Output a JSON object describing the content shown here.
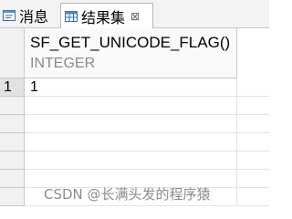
{
  "tabs": [
    {
      "label": "消息",
      "icon": "messages-icon",
      "active": false
    },
    {
      "label": "结果集",
      "icon": "table-icon",
      "active": true,
      "close": "⊠"
    }
  ],
  "grid": {
    "column": {
      "name": "SF_GET_UNICODE_FLAG()",
      "type": "INTEGER"
    },
    "rows": [
      {
        "number": "1",
        "value": "1"
      },
      {
        "number": "",
        "value": ""
      },
      {
        "number": "",
        "value": ""
      },
      {
        "number": "",
        "value": ""
      },
      {
        "number": "",
        "value": ""
      },
      {
        "number": "",
        "value": ""
      },
      {
        "number": "",
        "value": ""
      }
    ]
  },
  "watermark": "CSDN @长满头发的程序猿"
}
